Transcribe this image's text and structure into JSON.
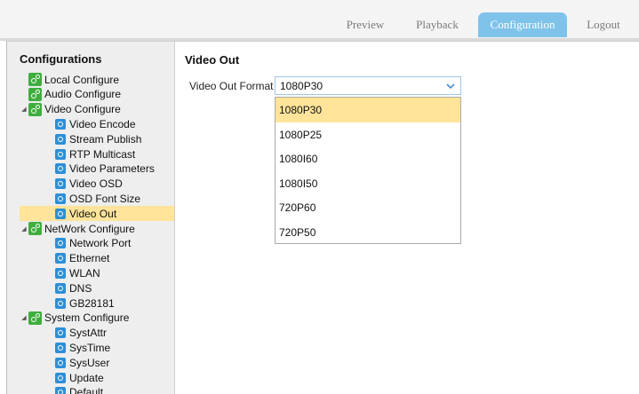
{
  "nav": {
    "preview": "Preview",
    "playback": "Playback",
    "configuration": "Configuration",
    "logout": "Logout",
    "active": "Configuration"
  },
  "sidebar": {
    "title": "Configurations",
    "items": [
      {
        "label": "Local Configure",
        "level": 0,
        "icon": "gear-icon"
      },
      {
        "label": "Audio Configure",
        "level": 0,
        "icon": "gear-icon"
      },
      {
        "label": "Video Configure",
        "level": 0,
        "icon": "gear-icon",
        "expanded": true
      },
      {
        "label": "Video Encode",
        "level": 1,
        "icon": "config-icon"
      },
      {
        "label": "Stream Publish",
        "level": 1,
        "icon": "config-icon"
      },
      {
        "label": "RTP Multicast",
        "level": 1,
        "icon": "config-icon"
      },
      {
        "label": "Video Parameters",
        "level": 1,
        "icon": "config-icon"
      },
      {
        "label": "Video OSD",
        "level": 1,
        "icon": "config-icon"
      },
      {
        "label": "OSD Font Size",
        "level": 1,
        "icon": "config-icon"
      },
      {
        "label": "Video Out",
        "level": 1,
        "icon": "config-icon",
        "selected": true
      },
      {
        "label": "NetWork Configure",
        "level": 0,
        "icon": "gear-icon",
        "expanded": true
      },
      {
        "label": "Network Port",
        "level": 1,
        "icon": "config-icon"
      },
      {
        "label": "Ethernet",
        "level": 1,
        "icon": "config-icon"
      },
      {
        "label": "WLAN",
        "level": 1,
        "icon": "config-icon"
      },
      {
        "label": "DNS",
        "level": 1,
        "icon": "config-icon"
      },
      {
        "label": "GB28181",
        "level": 1,
        "icon": "config-icon"
      },
      {
        "label": "System Configure",
        "level": 0,
        "icon": "gear-icon",
        "expanded": true
      },
      {
        "label": "SystAttr",
        "level": 1,
        "icon": "config-icon"
      },
      {
        "label": "SysTime",
        "level": 1,
        "icon": "config-icon"
      },
      {
        "label": "SysUser",
        "level": 1,
        "icon": "config-icon"
      },
      {
        "label": "Update",
        "level": 1,
        "icon": "config-icon"
      },
      {
        "label": "Default",
        "level": 1,
        "icon": "config-icon"
      }
    ]
  },
  "main": {
    "title": "Video Out",
    "field_label": "Video Out Format",
    "selected_value": "1080P30",
    "options": [
      "1080P30",
      "1080P25",
      "1080I60",
      "1080I50",
      "720P60",
      "720P50"
    ],
    "highlighted_option": "1080P30"
  },
  "colors": {
    "accent": "#7fc3ea",
    "selection": "#ffe49a",
    "tree_node_green": "#3fae3f",
    "tree_leaf_blue": "#2e8fd6"
  }
}
